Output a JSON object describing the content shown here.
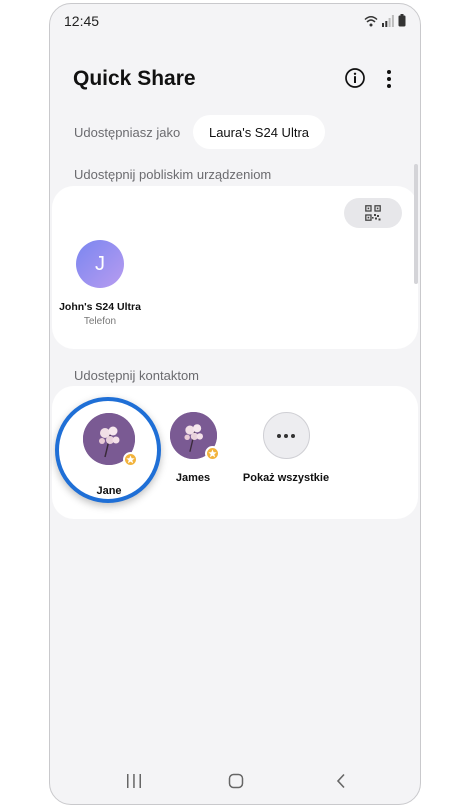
{
  "status_bar": {
    "time": "12:45"
  },
  "header": {
    "title": "Quick Share"
  },
  "share_as": {
    "label": "Udostępniasz jako",
    "device_name": "Laura's S24 Ultra"
  },
  "nearby": {
    "label": "Udostępnij pobliskim urządzeniom",
    "devices": [
      {
        "initial": "J",
        "name": "John's S24 Ultra",
        "type": "Telefon"
      }
    ]
  },
  "contacts": {
    "label": "Udostępnij kontaktom",
    "items": [
      {
        "name": "Jane"
      },
      {
        "name": "James"
      }
    ],
    "show_all_label": "Pokaż wszystkie"
  },
  "colors": {
    "highlight_ring": "#1f6fd6",
    "favorite_star": "#f2b33c",
    "contact_photo_bg": "#7a5a93"
  },
  "icons": [
    "info-icon",
    "more-vertical-icon",
    "qr-code-icon",
    "star-icon",
    "more-horizontal-icon",
    "recent-apps-icon",
    "home-icon",
    "back-icon",
    "wifi-icon",
    "signal-icon",
    "battery-icon"
  ]
}
